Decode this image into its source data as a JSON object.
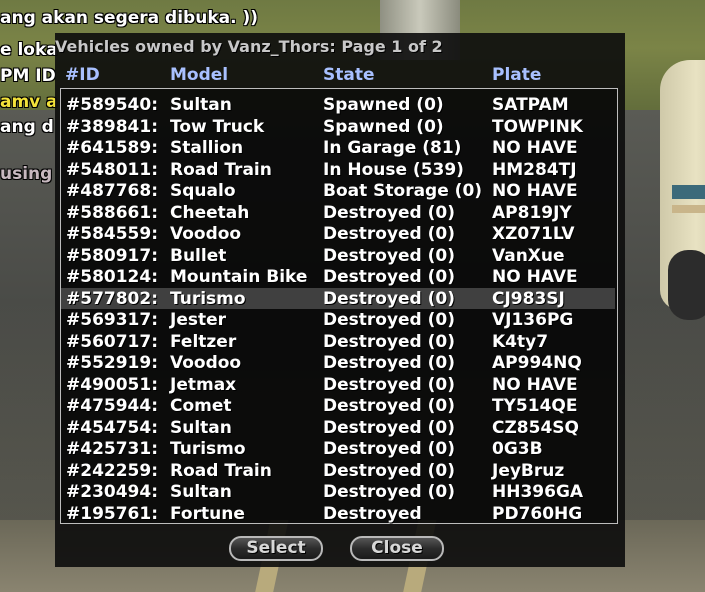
{
  "chat": [
    {
      "text": "ang akan segera dibuka. ))",
      "style": "white"
    },
    {
      "text": "e loka",
      "style": "white"
    },
    {
      "text": "PM ID",
      "style": "white"
    },
    {
      "text": "amv a",
      "style": "yellow"
    },
    {
      "text": "ang d",
      "style": "white"
    },
    {
      "text": "using",
      "style": "dim"
    }
  ],
  "dialog": {
    "title": "Vehicles owned by Vanz_Thors: Page 1 of 2",
    "columns": {
      "id": "#ID",
      "model": "Model",
      "state": "State",
      "plate": "Plate"
    },
    "selected_index": 9,
    "rows": [
      {
        "id": "#589540:",
        "model": "Sultan",
        "state": "Spawned (0)",
        "plate": "SATPAM"
      },
      {
        "id": "#389841:",
        "model": "Tow Truck",
        "state": "Spawned (0)",
        "plate": "TOWPINK"
      },
      {
        "id": "#641589:",
        "model": "Stallion",
        "state": "In Garage (81)",
        "plate": "NO HAVE"
      },
      {
        "id": "#548011:",
        "model": "Road Train",
        "state": "In House (539)",
        "plate": "HM284TJ"
      },
      {
        "id": "#487768:",
        "model": "Squalo",
        "state": "Boat Storage (0)",
        "plate": "NO HAVE"
      },
      {
        "id": "#588661:",
        "model": "Cheetah",
        "state": "Destroyed (0)",
        "plate": "AP819JY"
      },
      {
        "id": "#584559:",
        "model": "Voodoo",
        "state": "Destroyed (0)",
        "plate": "XZ071LV"
      },
      {
        "id": "#580917:",
        "model": "Bullet",
        "state": "Destroyed (0)",
        "plate": "VanXue"
      },
      {
        "id": "#580124:",
        "model": "Mountain Bike",
        "state": "Destroyed (0)",
        "plate": "NO HAVE"
      },
      {
        "id": "#577802:",
        "model": "Turismo",
        "state": "Destroyed (0)",
        "plate": "CJ983SJ"
      },
      {
        "id": "#569317:",
        "model": "Jester",
        "state": "Destroyed (0)",
        "plate": "VJ136PG"
      },
      {
        "id": "#560717:",
        "model": "Feltzer",
        "state": "Destroyed (0)",
        "plate": "K4ty7"
      },
      {
        "id": "#552919:",
        "model": "Voodoo",
        "state": "Destroyed (0)",
        "plate": "AP994NQ"
      },
      {
        "id": "#490051:",
        "model": "Jetmax",
        "state": "Destroyed (0)",
        "plate": "NO HAVE"
      },
      {
        "id": "#475944:",
        "model": "Comet",
        "state": "Destroyed (0)",
        "plate": "TY514QE"
      },
      {
        "id": "#454754:",
        "model": "Sultan",
        "state": "Destroyed (0)",
        "plate": "CZ854SQ"
      },
      {
        "id": "#425731:",
        "model": "Turismo",
        "state": "Destroyed (0)",
        "plate": "0G3B"
      },
      {
        "id": "#242259:",
        "model": "Road Train",
        "state": "Destroyed (0)",
        "plate": "JeyBruz"
      },
      {
        "id": "#230494:",
        "model": "Sultan",
        "state": "Destroyed (0)",
        "plate": "HH396GA"
      },
      {
        "id": "#195761:",
        "model": "Fortune",
        "state": "Destroyed",
        "plate": "PD760HG"
      }
    ],
    "buttons": {
      "select": "Select",
      "close": "Close"
    }
  }
}
